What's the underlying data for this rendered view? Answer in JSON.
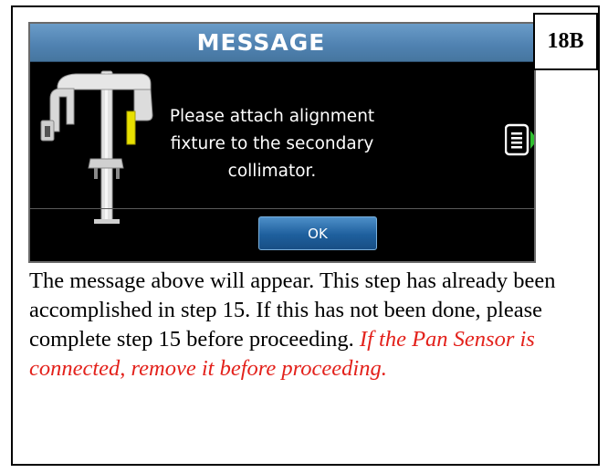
{
  "dialog": {
    "title": "MESSAGE",
    "message": "Please attach alignment fixture to the secondary collimator.",
    "ok_label": "OK",
    "title_bar_color": "#4f81b0",
    "highlight_color": "#e8e000",
    "arrow_color": "#2fbf2f",
    "icons": {
      "device": "panoramic-xray-unit-icon",
      "document": "document-icon",
      "next": "green-arrow-right-icon"
    }
  },
  "page_badge": "18B",
  "instructions": {
    "text": "The message above will appear. This step has already been accomplished in step 15. If this has not been done, please complete step 15 before proceeding. ",
    "warning": "If the Pan Sensor is connected, remove it before proceeding.",
    "warning_color": "#e3211b"
  }
}
